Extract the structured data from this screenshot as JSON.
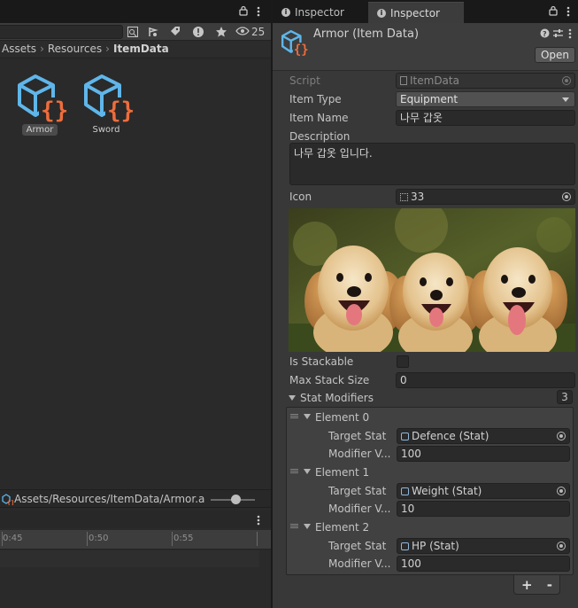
{
  "project": {
    "visible_count": "25",
    "breadcrumb": [
      "Assets",
      "Resources",
      "ItemData"
    ],
    "assets": [
      {
        "name": "Armor",
        "icon": "scriptable-object-icon",
        "selected": true
      },
      {
        "name": "Sword",
        "icon": "scriptable-object-icon",
        "selected": false
      }
    ],
    "selected_path": "Assets/Resources/ItemData/Armor.asset",
    "timeline_ticks": [
      "0:45",
      "0:50",
      "0:55"
    ]
  },
  "tabs": [
    {
      "label": "Inspector",
      "icon": "info-icon",
      "active": false
    },
    {
      "label": "Inspector",
      "icon": "info-icon",
      "active": true
    }
  ],
  "inspector": {
    "title": "Armor (Item Data)",
    "open_label": "Open",
    "script": {
      "label": "Script",
      "value": "ItemData"
    },
    "item_type": {
      "label": "Item Type",
      "value": "Equipment"
    },
    "item_name": {
      "label": "Item Name",
      "value": "나무 갑옷"
    },
    "description": {
      "label": "Description",
      "value": "나무 갑옷 입니다."
    },
    "icon": {
      "label": "Icon",
      "value": "33"
    },
    "is_stackable": {
      "label": "Is Stackable",
      "checked": false
    },
    "max_stack_size": {
      "label": "Max Stack Size",
      "value": "0"
    },
    "stat_modifiers": {
      "label": "Stat Modifiers",
      "count": "3",
      "target_label": "Target Stat",
      "modifier_label": "Modifier V...",
      "elements": [
        {
          "name": "Element 0",
          "target": "Defence (Stat)",
          "modifier": "100"
        },
        {
          "name": "Element 1",
          "target": "Weight (Stat)",
          "modifier": "10"
        },
        {
          "name": "Element 2",
          "target": "HP (Stat)",
          "modifier": "100"
        }
      ]
    }
  },
  "colors": {
    "accent_blue": "#5fb6ea",
    "script_orange": "#ee6d3c",
    "panel": "#383838"
  }
}
